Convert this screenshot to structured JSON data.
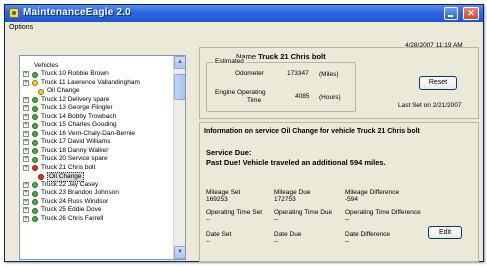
{
  "window": {
    "title": "MaintenanceEagle 2.0",
    "close_glyph": "✕"
  },
  "menu": {
    "options": "Options"
  },
  "datetime": "4/28/2007 11:19 AM",
  "tree": {
    "header": "Vehicles",
    "items": [
      {
        "label": "Truck 10 Robbie Brown",
        "status": "green",
        "level": 0
      },
      {
        "label": "Truck 11 Lawrence Vallandingham",
        "status": "yellow",
        "level": 0
      },
      {
        "label": "Oil Change",
        "status": "yellow",
        "level": 1
      },
      {
        "label": "Truck 12 Delivery spare",
        "status": "green",
        "level": 0
      },
      {
        "label": "Truck 13 George Flingler",
        "status": "green",
        "level": 0
      },
      {
        "label": "Truck 14 Bobby Trowbach",
        "status": "green",
        "level": 0
      },
      {
        "label": "Truck 15 Charles Gooding",
        "status": "green",
        "level": 0
      },
      {
        "label": "Truck 16 Vern-Chaly-Dan-Bernie",
        "status": "green",
        "level": 0
      },
      {
        "label": "Truck 17 David Williams",
        "status": "green",
        "level": 0
      },
      {
        "label": "Truck 18 Danny Walker",
        "status": "green",
        "level": 0
      },
      {
        "label": "Truck 20 Service spare",
        "status": "green",
        "level": 0
      },
      {
        "label": "Truck 21 Chris bolt",
        "status": "red",
        "level": 0
      },
      {
        "label": "Oil Change",
        "status": "red",
        "level": 1,
        "selected": true
      },
      {
        "label": "Truck 22 Jay Casey",
        "status": "green",
        "level": 0
      },
      {
        "label": "Truck 23 Brandon Johnson",
        "status": "green",
        "level": 0
      },
      {
        "label": "Truck 24 Russ Windsor",
        "status": "green",
        "level": 0
      },
      {
        "label": "Truck 25 Eddie Dove",
        "status": "green",
        "level": 0
      },
      {
        "label": "Truck 26 Chris Farrell",
        "status": "green",
        "level": 0
      }
    ]
  },
  "summary": {
    "name_label": "Name",
    "name_value": "Truck 21 Chris bolt",
    "estimated_legend": "Estimated",
    "odometer_label": "Odometer",
    "odometer_value": "173347",
    "odometer_unit": "(Miles)",
    "engine_label_1": "Engine Operating",
    "engine_label_2": "Time",
    "engine_value": "4085",
    "engine_unit": "(Hours)",
    "reset_label": "Reset",
    "last_set": "Last Set on 2/21/2007"
  },
  "info": {
    "title": "Information on service Oil Change for vehicle Truck 21 Chris bolt",
    "service_due": "Service Due:",
    "past_due": "Past Due! Vehicle traveled an additional 594 miles.",
    "mileage_set_label": "Mileage Set",
    "mileage_set_value": "169253",
    "mileage_due_label": "Mileage Due",
    "mileage_due_value": "172753",
    "mileage_diff_label": "Mileage Difference",
    "mileage_diff_value": "-594",
    "op_set_label": "Operating Time Set",
    "op_set_value": "--",
    "op_due_label": "Operating Time Due",
    "op_due_value": "--",
    "op_diff_label": "Operating Time Difference",
    "op_diff_value": "--",
    "date_set_label": "Date Set",
    "date_set_value": "--",
    "date_due_label": "Date Due",
    "date_due_value": "--",
    "date_diff_label": "Date Difference",
    "date_diff_value": "--",
    "edit_label": "Edit"
  }
}
